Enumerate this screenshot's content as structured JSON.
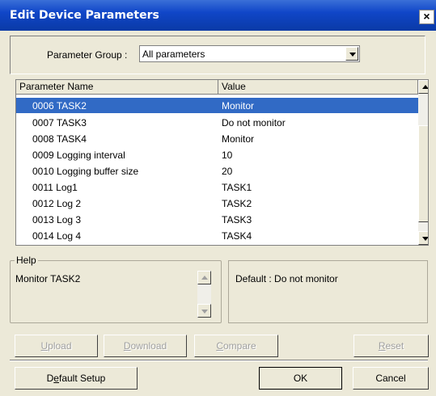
{
  "window": {
    "title": "Edit Device Parameters",
    "close_glyph": "×"
  },
  "group": {
    "label": "Parameter Group :",
    "selected": "All parameters"
  },
  "table": {
    "columns": [
      "Parameter Name",
      "Value"
    ],
    "rows": [
      {
        "name": "0006 TASK2",
        "value": "Monitor",
        "selected": true
      },
      {
        "name": "0007 TASK3",
        "value": "Do not monitor"
      },
      {
        "name": "0008 TASK4",
        "value": "Monitor"
      },
      {
        "name": "0009 Logging interval",
        "value": "10"
      },
      {
        "name": "0010 Logging buffer size",
        "value": "20"
      },
      {
        "name": "0011 Log1",
        "value": "TASK1"
      },
      {
        "name": "0012 Log 2",
        "value": "TASK2"
      },
      {
        "name": "0013 Log 3",
        "value": "TASK3"
      },
      {
        "name": "0014 Log 4",
        "value": "TASK4"
      }
    ]
  },
  "help": {
    "label": "Help",
    "text": "Monitor TASK2",
    "default_text": "Default : Do not monitor"
  },
  "buttons": {
    "upload": {
      "first": "U",
      "rest": "pload"
    },
    "download": {
      "first": "D",
      "rest": "ownload"
    },
    "compare": {
      "first": "C",
      "rest": "ompare"
    },
    "reset": {
      "first": "R",
      "rest": "eset"
    },
    "default_setup": {
      "pre": "D",
      "ul": "e",
      "rest": "fault Setup"
    },
    "ok": "OK",
    "cancel": "Cancel"
  },
  "colors": {
    "titlebar": "#0a3aa6",
    "selection": "#316ac5",
    "dialog_bg": "#ece9d8"
  },
  "icons": [
    "close-icon",
    "dropdown-arrow-icon",
    "scroll-up-arrow-icon",
    "scroll-down-arrow-icon"
  ]
}
